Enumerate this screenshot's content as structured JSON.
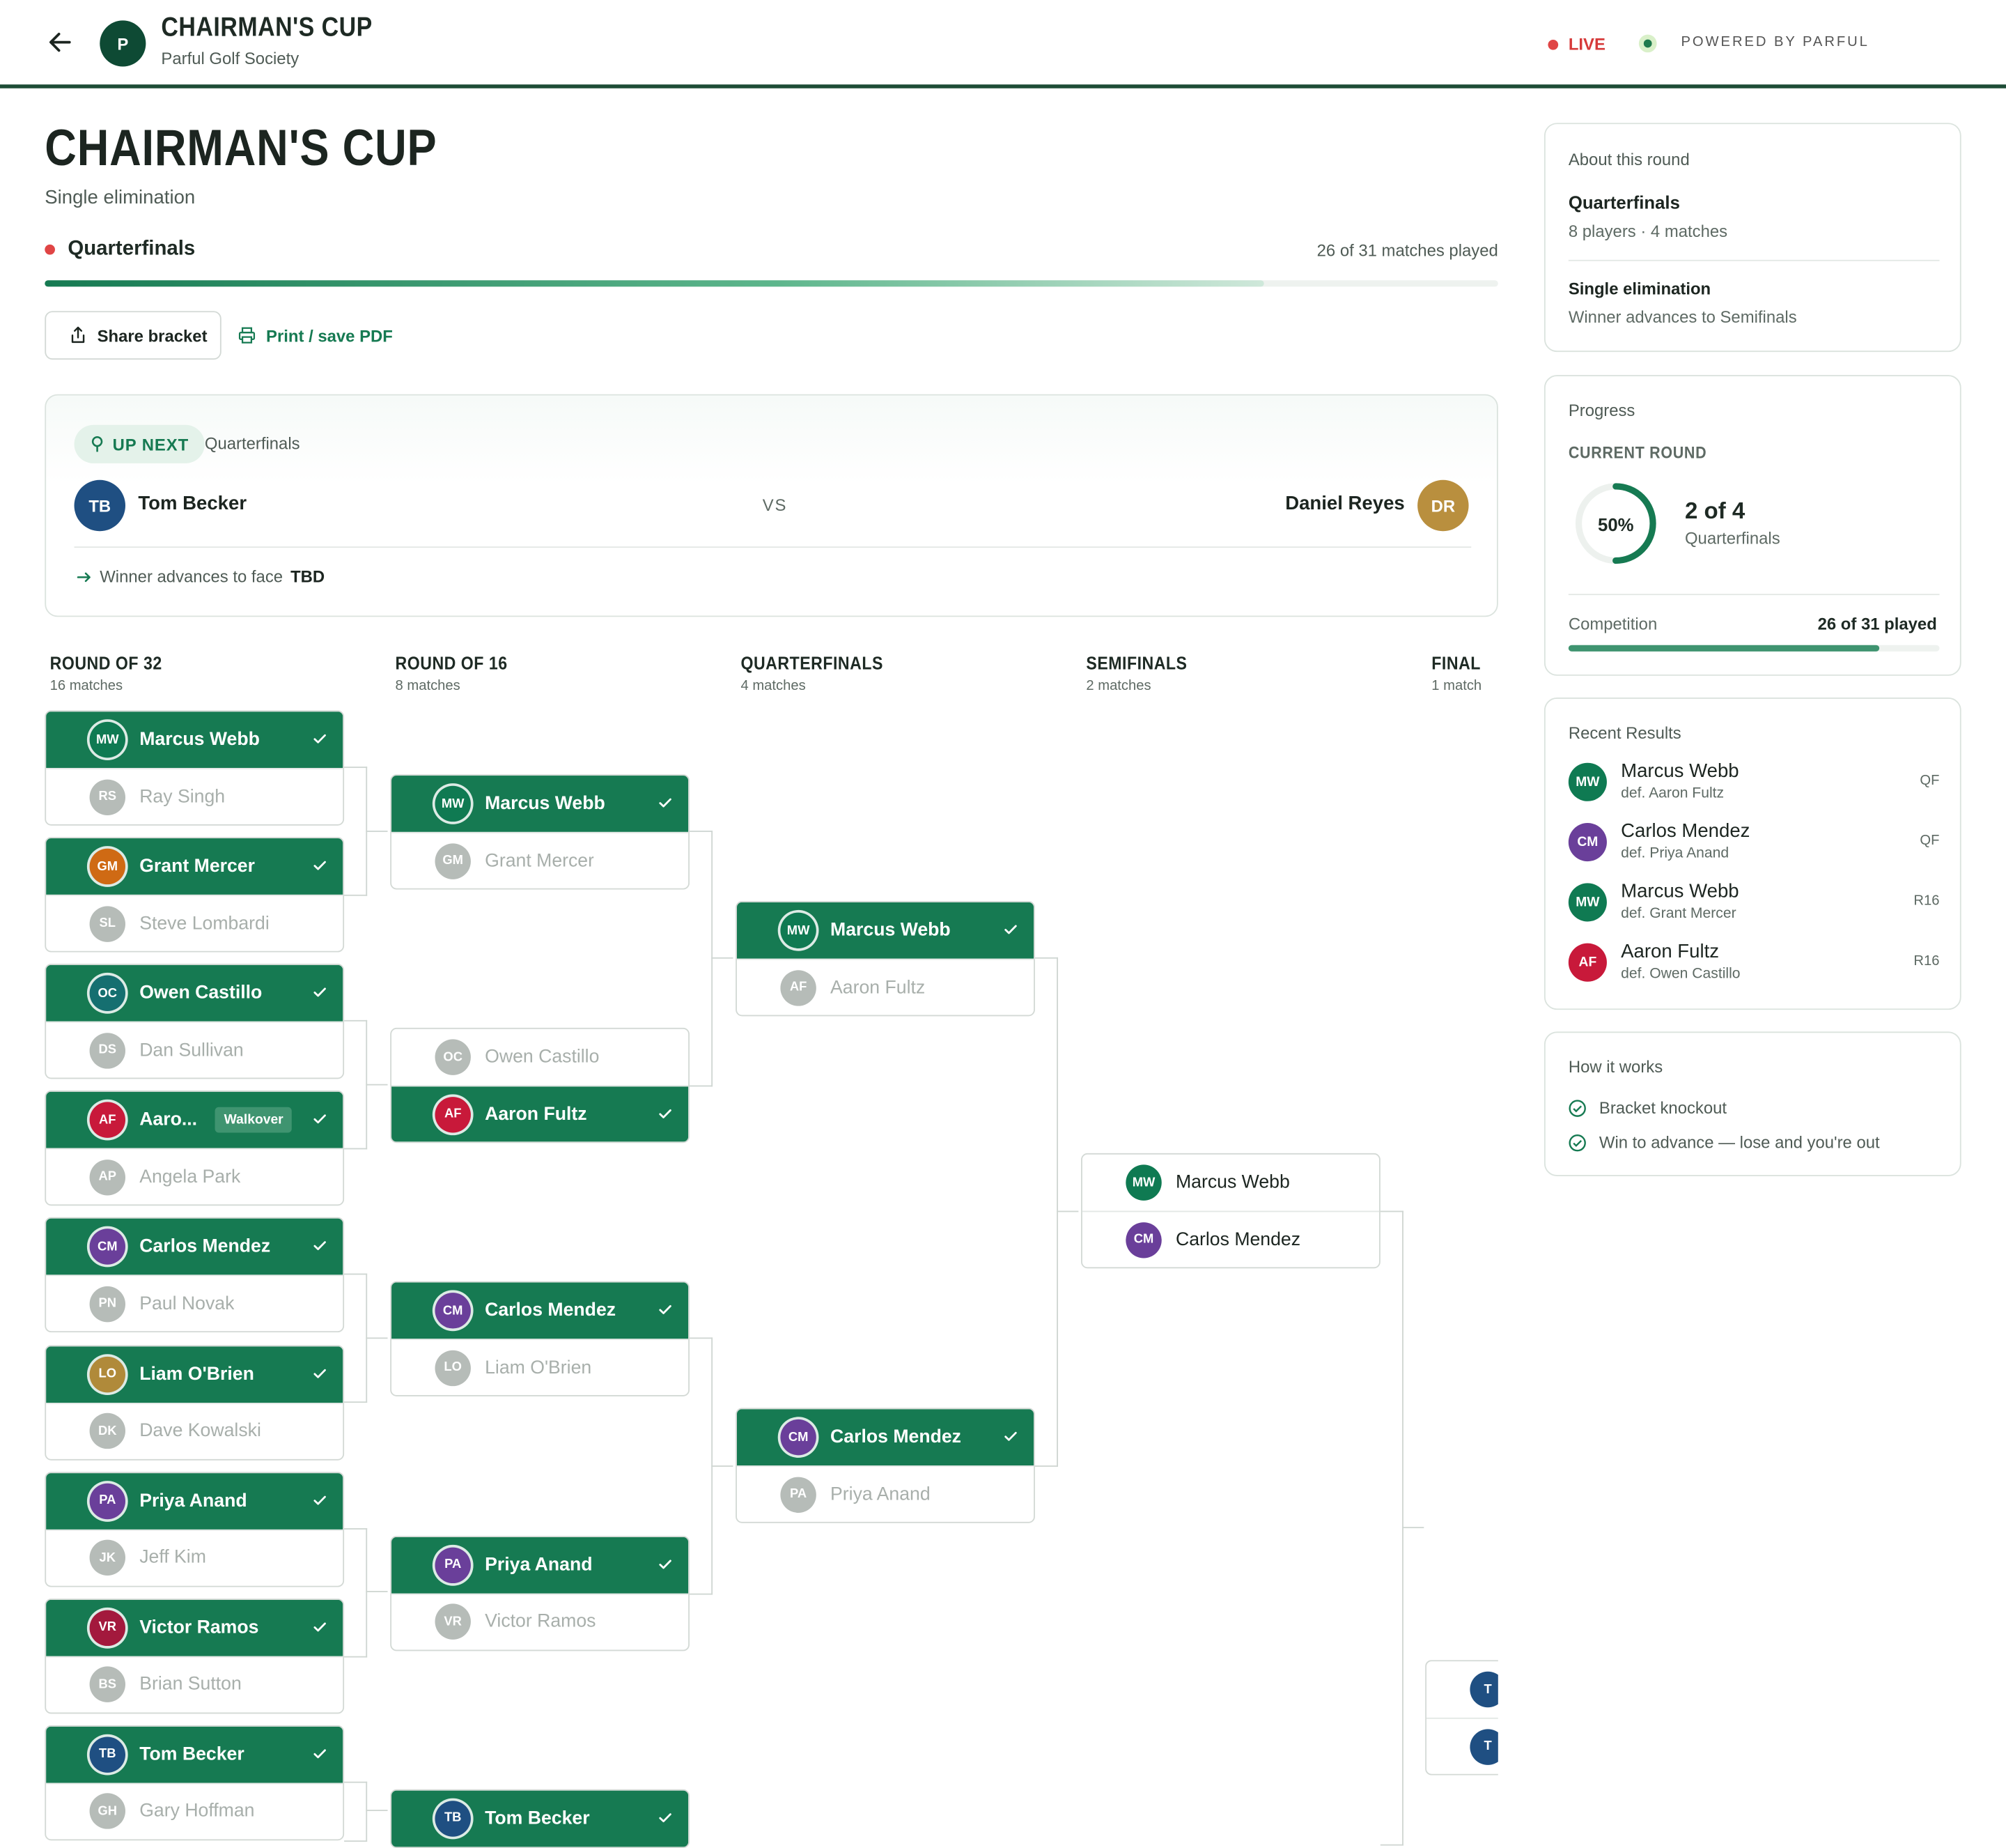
{
  "header": {
    "logo_letter": "P",
    "title": "CHAIRMAN'S CUP",
    "subtitle": "Parful Golf Society",
    "live_label": "LIVE",
    "powered_by": "POWERED BY PARFUL"
  },
  "page": {
    "title": "CHAIRMAN'S CUP",
    "format": "Single elimination",
    "current_round": "Quarterfinals",
    "matches_played": "26 of 31 matches played",
    "progress_fraction": 0.839,
    "share_label": "Share bracket",
    "print_label": "Print / save PDF"
  },
  "up_next": {
    "badge": "UP NEXT",
    "round": "Quarterfinals",
    "player1": {
      "initials": "TB",
      "name": "Tom Becker"
    },
    "vs": "VS",
    "player2": {
      "initials": "DR",
      "name": "Daniel Reyes"
    },
    "advance_text": "Winner advances to face",
    "advance_target": "TBD"
  },
  "columns": [
    {
      "title": "ROUND OF 32",
      "sub": "16 matches"
    },
    {
      "title": "ROUND OF 16",
      "sub": "8 matches"
    },
    {
      "title": "QUARTERFINALS",
      "sub": "4 matches"
    },
    {
      "title": "SEMIFINALS",
      "sub": "2 matches"
    },
    {
      "title": "FINAL",
      "sub": "1 match"
    }
  ],
  "r32": [
    {
      "p1": {
        "i": "MW",
        "n": "Marcus Webb",
        "s": "win"
      },
      "p2": {
        "i": "RS",
        "n": "Ray Singh",
        "s": "lose"
      }
    },
    {
      "p1": {
        "i": "GM",
        "n": "Grant Mercer",
        "s": "win"
      },
      "p2": {
        "i": "SL",
        "n": "Steve Lombardi",
        "s": "lose"
      }
    },
    {
      "p1": {
        "i": "OC",
        "n": "Owen Castillo",
        "s": "win"
      },
      "p2": {
        "i": "DS",
        "n": "Dan Sullivan",
        "s": "lose"
      }
    },
    {
      "p1": {
        "i": "AF",
        "n": "Aaro...",
        "s": "win",
        "tag": "Walkover"
      },
      "p2": {
        "i": "AP",
        "n": "Angela Park",
        "s": "lose"
      }
    },
    {
      "p1": {
        "i": "CM",
        "n": "Carlos Mendez",
        "s": "win"
      },
      "p2": {
        "i": "PN",
        "n": "Paul Novak",
        "s": "lose"
      }
    },
    {
      "p1": {
        "i": "LO",
        "n": "Liam O'Brien",
        "s": "win"
      },
      "p2": {
        "i": "DK",
        "n": "Dave Kowalski",
        "s": "lose"
      }
    },
    {
      "p1": {
        "i": "PA",
        "n": "Priya Anand",
        "s": "win"
      },
      "p2": {
        "i": "JK",
        "n": "Jeff Kim",
        "s": "lose"
      }
    },
    {
      "p1": {
        "i": "VR",
        "n": "Victor Ramos",
        "s": "win"
      },
      "p2": {
        "i": "BS",
        "n": "Brian Sutton",
        "s": "lose"
      }
    },
    {
      "p1": {
        "i": "TB",
        "n": "Tom Becker",
        "s": "win"
      },
      "p2": {
        "i": "GH",
        "n": "Gary Hoffman",
        "s": "lose"
      }
    }
  ],
  "r16": [
    {
      "p1": {
        "i": "MW",
        "n": "Marcus Webb",
        "s": "win"
      },
      "p2": {
        "i": "GM",
        "n": "Grant Mercer",
        "s": "lose"
      }
    },
    {
      "p1": {
        "i": "OC",
        "n": "Owen Castillo",
        "s": "lose"
      },
      "p2": {
        "i": "AF",
        "n": "Aaron Fultz",
        "s": "win"
      }
    },
    {
      "p1": {
        "i": "CM",
        "n": "Carlos Mendez",
        "s": "win"
      },
      "p2": {
        "i": "LO",
        "n": "Liam O'Brien",
        "s": "lose"
      }
    },
    {
      "p1": {
        "i": "PA",
        "n": "Priya Anand",
        "s": "win"
      },
      "p2": {
        "i": "VR",
        "n": "Victor Ramos",
        "s": "lose"
      }
    },
    {
      "p1": {
        "i": "TB",
        "n": "Tom Becker",
        "s": "win"
      }
    }
  ],
  "qf": [
    {
      "p1": {
        "i": "MW",
        "n": "Marcus Webb",
        "s": "win"
      },
      "p2": {
        "i": "AF",
        "n": "Aaron Fultz",
        "s": "lose"
      }
    },
    {
      "p1": {
        "i": "CM",
        "n": "Carlos Mendez",
        "s": "win"
      },
      "p2": {
        "i": "PA",
        "n": "Priya Anand",
        "s": "lose"
      }
    }
  ],
  "sf": [
    {
      "p1": {
        "i": "MW",
        "n": "Marcus Webb",
        "s": "neu"
      },
      "p2": {
        "i": "CM",
        "n": "Carlos Mendez",
        "s": "neu"
      }
    }
  ],
  "final_partial": {
    "p1": {
      "i": "T",
      "n": "",
      "s": "neu"
    },
    "p2": {
      "i": "T",
      "n": "",
      "s": "neu"
    }
  },
  "sidebar": {
    "about": {
      "title": "About this round",
      "round": "Quarterfinals",
      "meta": "8 players · 4 matches",
      "format": "Single elimination",
      "advance": "Winner advances to Semifinals"
    },
    "progress": {
      "title": "Progress",
      "current_label": "CURRENT ROUND",
      "percent_text": "50%",
      "percent_value": 50,
      "count": "2 of 4",
      "round": "Quarterfinals",
      "competition_label": "Competition",
      "competition_value": "26 of 31 played",
      "competition_fraction": 0.839
    },
    "recent": {
      "title": "Recent Results",
      "items": [
        {
          "i": "MW",
          "name": "Marcus Webb",
          "def": "def. Aaron Fultz",
          "tag": "QF"
        },
        {
          "i": "CM",
          "name": "Carlos Mendez",
          "def": "def. Priya Anand",
          "tag": "QF"
        },
        {
          "i": "MW",
          "name": "Marcus Webb",
          "def": "def. Grant Mercer",
          "tag": "R16"
        },
        {
          "i": "AF",
          "name": "Aaron Fultz",
          "def": "def. Owen Castillo",
          "tag": "R16"
        }
      ]
    },
    "how": {
      "title": "How it works",
      "items": [
        "Bracket knockout",
        "Win to advance — lose and you're out"
      ]
    }
  },
  "colors": {
    "brand": "#167a52",
    "live": "#e04545",
    "dark": "#0e4a34"
  }
}
